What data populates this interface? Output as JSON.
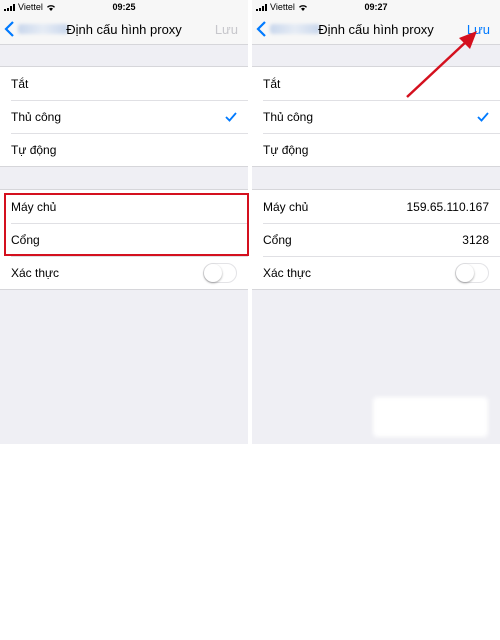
{
  "screens": [
    {
      "status": {
        "carrier": "Viettel",
        "time": "09:25"
      },
      "nav": {
        "title": "Định cấu hình proxy",
        "save_label": "Lưu"
      },
      "mode_options": [
        {
          "label": "Tắt",
          "selected": false
        },
        {
          "label": "Thủ công",
          "selected": true
        },
        {
          "label": "Tự động",
          "selected": false
        }
      ],
      "fields": [
        {
          "label": "Máy chủ",
          "value": ""
        },
        {
          "label": "Cổng",
          "value": ""
        }
      ],
      "auth": {
        "label": "Xác thực",
        "enabled": false
      }
    },
    {
      "status": {
        "carrier": "Viettel",
        "time": "09:27"
      },
      "nav": {
        "title": "Định cấu hình proxy",
        "save_label": "Lưu"
      },
      "mode_options": [
        {
          "label": "Tắt",
          "selected": false
        },
        {
          "label": "Thủ công",
          "selected": true
        },
        {
          "label": "Tự động",
          "selected": false
        }
      ],
      "fields": [
        {
          "label": "Máy chủ",
          "value": "159.65.110.167"
        },
        {
          "label": "Cổng",
          "value": "3128"
        }
      ],
      "auth": {
        "label": "Xác thực",
        "enabled": false
      }
    }
  ],
  "colors": {
    "accent": "#007aff",
    "annotation_red": "#d4101e",
    "background": "#efeff4"
  }
}
